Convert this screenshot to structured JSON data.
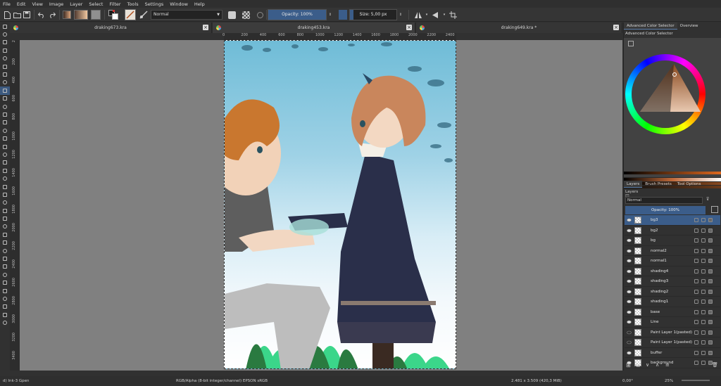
{
  "menu": [
    "File",
    "Edit",
    "View",
    "Image",
    "Layer",
    "Select",
    "Filter",
    "Tools",
    "Settings",
    "Window",
    "Help"
  ],
  "toolbar": {
    "blend_mode": "Normal",
    "opacity_label": "Opacity: 100%",
    "opacity_value": 1.0,
    "size_label": "Size: 5,00 px"
  },
  "tabs": [
    {
      "title": "draking673.kra"
    },
    {
      "title": "draking453.kra"
    },
    {
      "title": "draking649.kra *"
    }
  ],
  "ruler_h": [
    "0",
    "200",
    "400",
    "600",
    "800",
    "1000",
    "1200",
    "1400",
    "1600",
    "1800",
    "2000",
    "2200",
    "2400"
  ],
  "ruler_v": [
    "2",
    "200",
    "400",
    "600",
    "800",
    "1000",
    "1200",
    "1400",
    "1600",
    "1800",
    "2000",
    "2200",
    "2400",
    "2600",
    "2800",
    "3000",
    "3200",
    "3400"
  ],
  "dock": {
    "top_tabs": [
      "Advanced Color Selector",
      "Overview"
    ],
    "color_selector_title": "Advanced Color Selector",
    "bottom_tabs": [
      "Layers",
      "Brush Presets",
      "Tool Options"
    ],
    "layers_title": "Layers",
    "layer_blend": "Normal",
    "layer_opacity": "Opacity: 100%",
    "layers": [
      {
        "name": "bg3",
        "selected": true,
        "visible": true
      },
      {
        "name": "bg2",
        "visible": true
      },
      {
        "name": "bg",
        "visible": true
      },
      {
        "name": "normal2",
        "visible": true
      },
      {
        "name": "normal1",
        "visible": true
      },
      {
        "name": "shading4",
        "visible": true
      },
      {
        "name": "shading3",
        "visible": true
      },
      {
        "name": "shading2",
        "visible": true
      },
      {
        "name": "shading1",
        "visible": true
      },
      {
        "name": "base",
        "visible": true
      },
      {
        "name": "Line",
        "visible": true
      },
      {
        "name": "Paint Layer 1(pasted)",
        "visible": false
      },
      {
        "name": "Paint Layer 1(pasted)",
        "visible": false
      },
      {
        "name": "buffer",
        "visible": true
      },
      {
        "name": "background",
        "visible": true
      }
    ]
  },
  "status": {
    "brush": "d) Ink-3 Gpen",
    "color_model": "RGB/Alpha (8-bit integer/channel)  EPSON  sRGB",
    "image_size": "2.481 x 3.509 (420,3 MiB)",
    "rotation": "0,00°",
    "zoom": "25%"
  },
  "colors": {
    "accent": "#5a7da8",
    "canvas_bg": "#808080",
    "panel": "#313131"
  }
}
